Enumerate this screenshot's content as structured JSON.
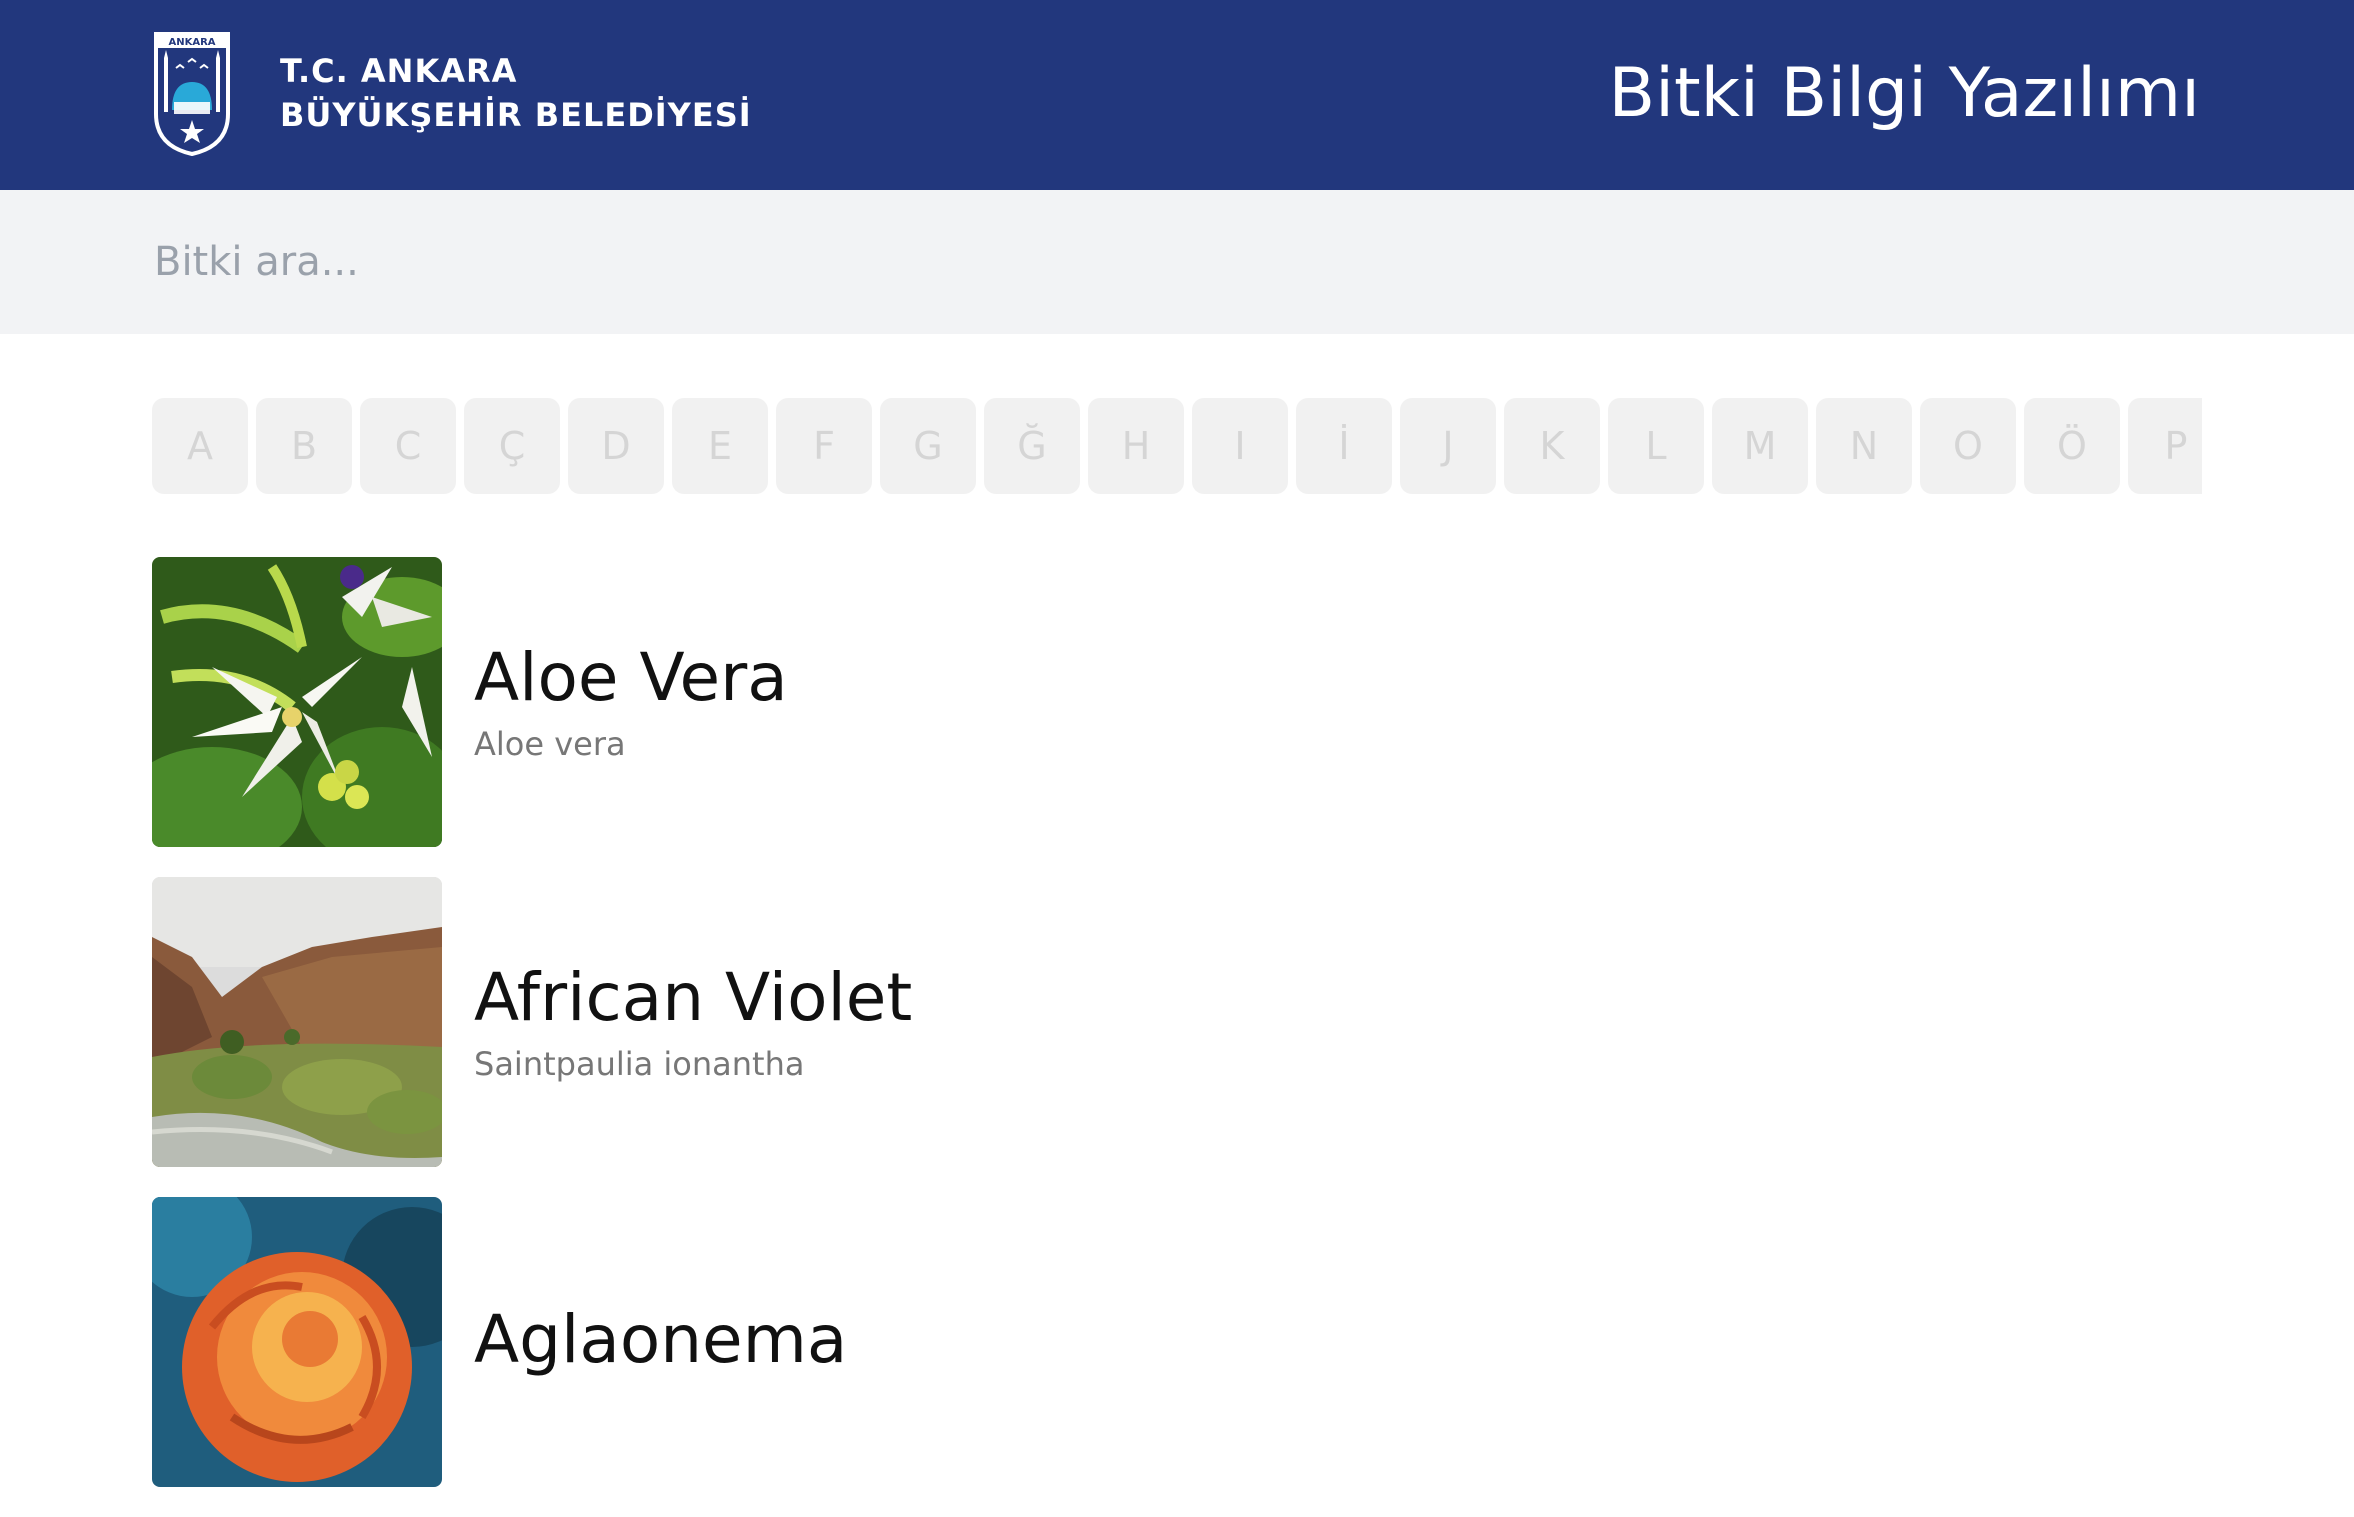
{
  "header": {
    "logo_label": "ANKARA",
    "org_line1": "T.C. ANKARA",
    "org_line2": "BÜYÜKŞEHİR BELEDİYESİ",
    "app_title": "Bitki Bilgi Yazılımı",
    "background_color": "#22377d"
  },
  "search": {
    "placeholder": "Bitki ara...",
    "value": ""
  },
  "alphabet": {
    "letters": [
      "A",
      "B",
      "C",
      "Ç",
      "D",
      "E",
      "F",
      "G",
      "Ğ",
      "H",
      "I",
      "İ",
      "J",
      "K",
      "L",
      "M",
      "N",
      "O",
      "Ö",
      "P"
    ]
  },
  "plants": [
    {
      "name": "Aloe Vera",
      "latin": "Aloe vera",
      "image": "white-lily-photo"
    },
    {
      "name": "African Violet",
      "latin": "Saintpaulia ionantha",
      "image": "mountain-valley-photo"
    },
    {
      "name": "Aglaonema",
      "latin": "",
      "image": "orange-rose-photo"
    }
  ]
}
